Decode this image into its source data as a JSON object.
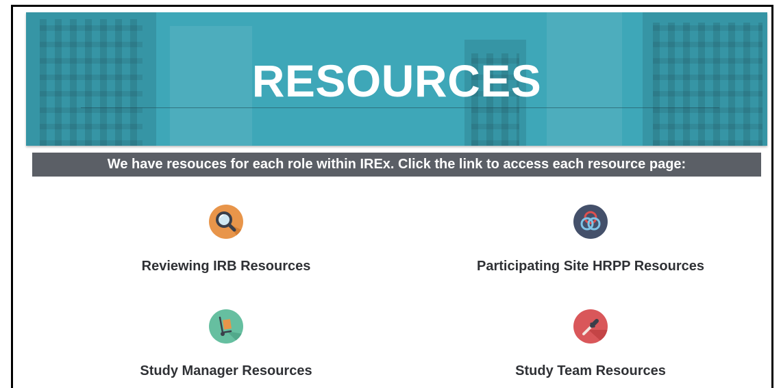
{
  "hero": {
    "title": "RESOURCES",
    "background_color": "#3ea7b8"
  },
  "banner": {
    "text": "We have resouces for each role within IREx. Click the link to access each resource page:",
    "background_color": "#5b5f66"
  },
  "resources": [
    {
      "label": "Reviewing IRB Resources",
      "icon": "magnifier-icon",
      "icon_color": "#e8954a"
    },
    {
      "label": "Participating Site HRPP Resources",
      "icon": "interlocking-rings-icon",
      "icon_color": "#44506a"
    },
    {
      "label": "Study Manager Resources",
      "icon": "hand-truck-icon",
      "icon_color": "#66bfa0"
    },
    {
      "label": "Study Team Resources",
      "icon": "pipette-icon",
      "icon_color": "#d9575a"
    }
  ]
}
